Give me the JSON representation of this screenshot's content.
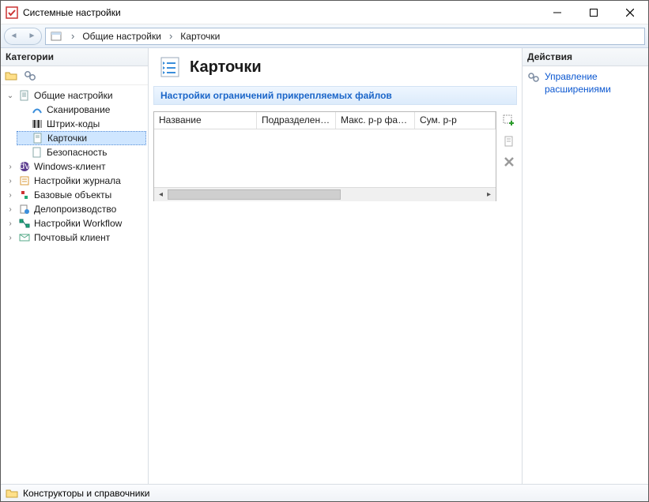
{
  "window": {
    "title": "Системные настройки"
  },
  "breadcrumb": {
    "items": [
      "Общие настройки",
      "Карточки"
    ]
  },
  "sidebar": {
    "header": "Категории",
    "tree": {
      "root_label": "Общие настройки",
      "children": [
        {
          "label": "Сканирование"
        },
        {
          "label": "Штрих-коды"
        },
        {
          "label": "Карточки",
          "selected": true
        },
        {
          "label": "Безопасность"
        }
      ],
      "siblings": [
        {
          "label": "Windows-клиент"
        },
        {
          "label": "Настройки журнала"
        },
        {
          "label": "Базовые объекты"
        },
        {
          "label": "Делопроизводство"
        },
        {
          "label": "Настройки Workflow"
        },
        {
          "label": "Почтовый клиент"
        }
      ]
    }
  },
  "content": {
    "title": "Карточки",
    "section": "Настройки ограничений прикрепляемых файлов",
    "columns": [
      "Название",
      "Подразделение",
      "Макс. р-р фай...",
      "Сум. р-р"
    ]
  },
  "actions_panel": {
    "header": "Действия",
    "items": [
      {
        "label": "Управление расширениями"
      }
    ]
  },
  "statusbar": {
    "text": "Конструкторы и справочники"
  }
}
